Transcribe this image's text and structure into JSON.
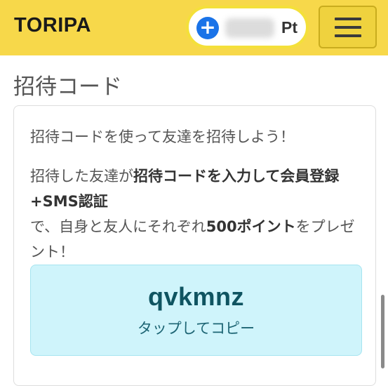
{
  "header": {
    "logo": "TORIPA",
    "points": {
      "add_icon": "plus-icon",
      "value": "",
      "unit": "Pt"
    },
    "menu_icon": "hamburger-menu-icon",
    "colors": {
      "background": "#f7d84a",
      "add_button": "#1a73e8"
    }
  },
  "page": {
    "title": "招待コード"
  },
  "card": {
    "lead": "招待コードを使って友達を招待しよう！",
    "desc": {
      "p1": "招待した友達が",
      "b1": "招待コードを入力して会員登録+SMS認証",
      "p2": "で、自身と友人にそれぞれ",
      "b2": "500ポイント",
      "p3": "をプレゼント！"
    },
    "code": {
      "value": "qvkmnz",
      "hint": "タップしてコピー",
      "colors": {
        "background": "#cff4fb",
        "text": "#0f5461"
      }
    }
  }
}
